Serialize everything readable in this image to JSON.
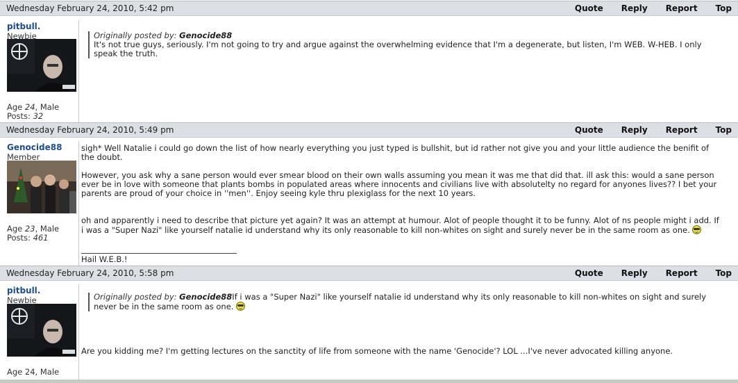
{
  "actions": {
    "quote": "Quote",
    "reply": "Reply",
    "report": "Report",
    "top": "Top"
  },
  "posts": [
    {
      "date": "Wednesday February 24, 2010, 5:42 pm",
      "author": {
        "name": "pitbull.",
        "rank": "Newbie",
        "age_label": "Age",
        "age": "24",
        "gender": ", Male",
        "posts_label": "Posts:",
        "posts": "32"
      },
      "quote": {
        "label": "Originally posted by:",
        "author": "Genocide88",
        "text": "It's not true guys, seriously. I'm not going to try and argue against the overwhelming evidence that I'm a degenerate, but listen, I'm WEB. W-HEB. I only speak the truth."
      }
    },
    {
      "date": "Wednesday February 24, 2010, 5:49 pm",
      "author": {
        "name": "Genocide88",
        "rank": "Member",
        "age_label": "Age",
        "age": "23",
        "gender": ", Male",
        "posts_label": "Posts:",
        "posts": "461"
      },
      "paragraphs": [
        "sigh* Well Natalie i could go down the list of how nearly everything you just typed is bullshit, but id rather not give you and your little audience the benifit of the doubt.",
        "However, you ask why a sane person would ever smear blood on their own walls assuming you mean it was me that did that. ill ask this: would a sane person ever be in love with someone that plants bombs in populated areas where innocents and civilians live with absolutelty no regard for anyones lives?? I bet your parents are proud of your choice in ''men''. Enjoy seeing kyle thru plexiglass for the next 10 years.",
        "oh and apparently i need to describe that picture yet again? It was an attempt at humour. Alot of people thought it to be funny. Alot of ns people might i add. If i was a \"Super Nazi\" like yourself natalie id understand why its only reasonable to kill non-whites on sight and surely never be in the same room as one."
      ],
      "signature": "Hail W.E.B.!"
    },
    {
      "date": "Wednesday February 24, 2010, 5:58 pm",
      "author": {
        "name": "pitbull.",
        "rank": "Newbie",
        "age_label": "Age",
        "age": "24",
        "gender": ", Male"
      },
      "quote": {
        "label": "Originally posted by:",
        "author": "Genocide88",
        "text": "If i was a \"Super Nazi\" like yourself natalie id understand why its only reasonable to kill non-whites on sight and surely never be in the same room as one."
      },
      "reply": "Are you kidding me? I'm getting lectures on the sanctity of life from someone with the name 'Genocide'? LOL ...I've never advocated killing anyone."
    }
  ]
}
